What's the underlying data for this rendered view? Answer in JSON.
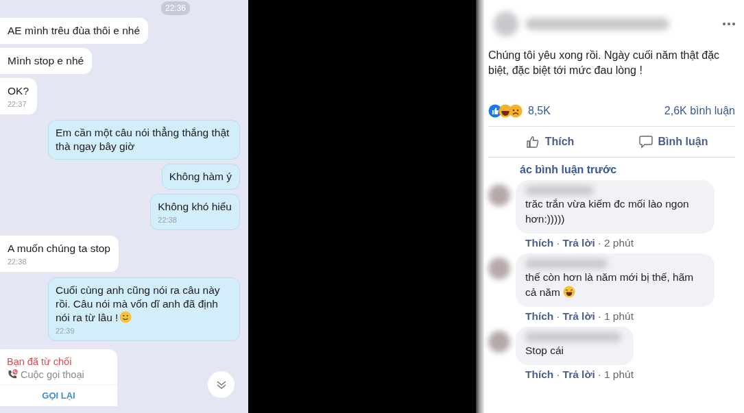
{
  "chat": {
    "date_chip": "22:36",
    "messages": [
      {
        "kind": "incoming",
        "text": "AE mình trêu đùa thôi e nhé"
      },
      {
        "kind": "incoming",
        "text": "Mình stop e nhé"
      },
      {
        "kind": "incoming",
        "text": "OK?",
        "time": "22:37"
      },
      {
        "kind": "outgoing",
        "text": "Em cần một câu nói thẳng thắng thật thà ngay bây giờ"
      },
      {
        "kind": "outgoing",
        "text": "Không hàm ý"
      },
      {
        "kind": "outgoing",
        "text": "Không khó hiểu",
        "time": "22:38"
      },
      {
        "kind": "incoming",
        "text": "A muốn chúng ta stop",
        "time": "22:38"
      },
      {
        "kind": "outgoing",
        "text": "Cuối cùng anh cũng nói ra câu này rồi. Câu nói mà vốn dĩ anh đã định nói ra từ lâu !",
        "emoji": true,
        "time": "22:39"
      }
    ],
    "call": {
      "status": "Bạn đã từ chối",
      "type": "Cuộc gọi thoại",
      "action": "GỌI LẠI"
    }
  },
  "post": {
    "text": "Chúng tôi yêu xong rồi. Ngày cuối năm thật đặc biệt, đặc biệt tới mức đau lòng !",
    "reactions_count": "8,5K",
    "comments_count": "2,6K bình luận",
    "actions": [
      {
        "kind": "like",
        "label": "Thích"
      },
      {
        "kind": "comment",
        "label": "Bình luận"
      }
    ],
    "previous_comments": "ác bình luận trước",
    "meta_separator": "·",
    "comments": [
      {
        "text": "trăc trắn vừa kiếm đc mối lào ngon hơn:)))))",
        "like": "Thích",
        "reply": "Trả lời",
        "time": "2 phút"
      },
      {
        "text": "thế còn hơn là năm mới bị thế, hãm cả năm",
        "emoji": true,
        "like": "Thích",
        "reply": "Trả lời",
        "time": "1 phút"
      },
      {
        "text": "Stop cái",
        "like": "Thích",
        "reply": "Trả lời",
        "time": "1 phút"
      }
    ]
  }
}
